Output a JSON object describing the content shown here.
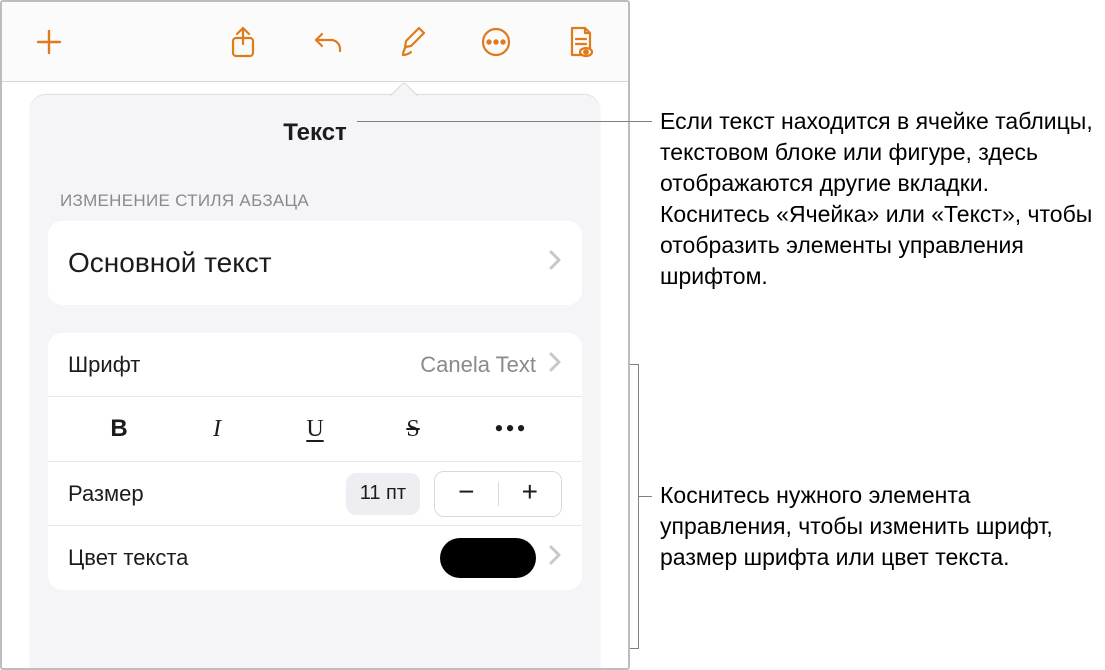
{
  "toolbar": {
    "icons": [
      "plus",
      "share",
      "undo",
      "brush",
      "more",
      "document-locked"
    ]
  },
  "popover": {
    "title": "Текст",
    "section_header": "ИЗМЕНЕНИЕ СТИЛЯ АБЗАЦА",
    "paragraph_style": "Основной текст",
    "font_label": "Шрифт",
    "font_value": "Canela Text",
    "style_buttons": {
      "bold": "B",
      "italic": "I",
      "underline": "U",
      "strike": "S",
      "more": "•••"
    },
    "size_label": "Размер",
    "size_value": "11 пт",
    "color_label": "Цвет текста",
    "color_swatch": "#000000"
  },
  "callouts": {
    "c1": "Если текст находится в ячейке таблицы, текстовом блоке или фигуре, здесь отображаются другие вкладки. Коснитесь «Ячейка» или «Текст», чтобы отобразить элементы управления шрифтом.",
    "c2": "Коснитесь нужного элемента управления, чтобы изменить шрифт, размер шрифта или цвет текста."
  }
}
